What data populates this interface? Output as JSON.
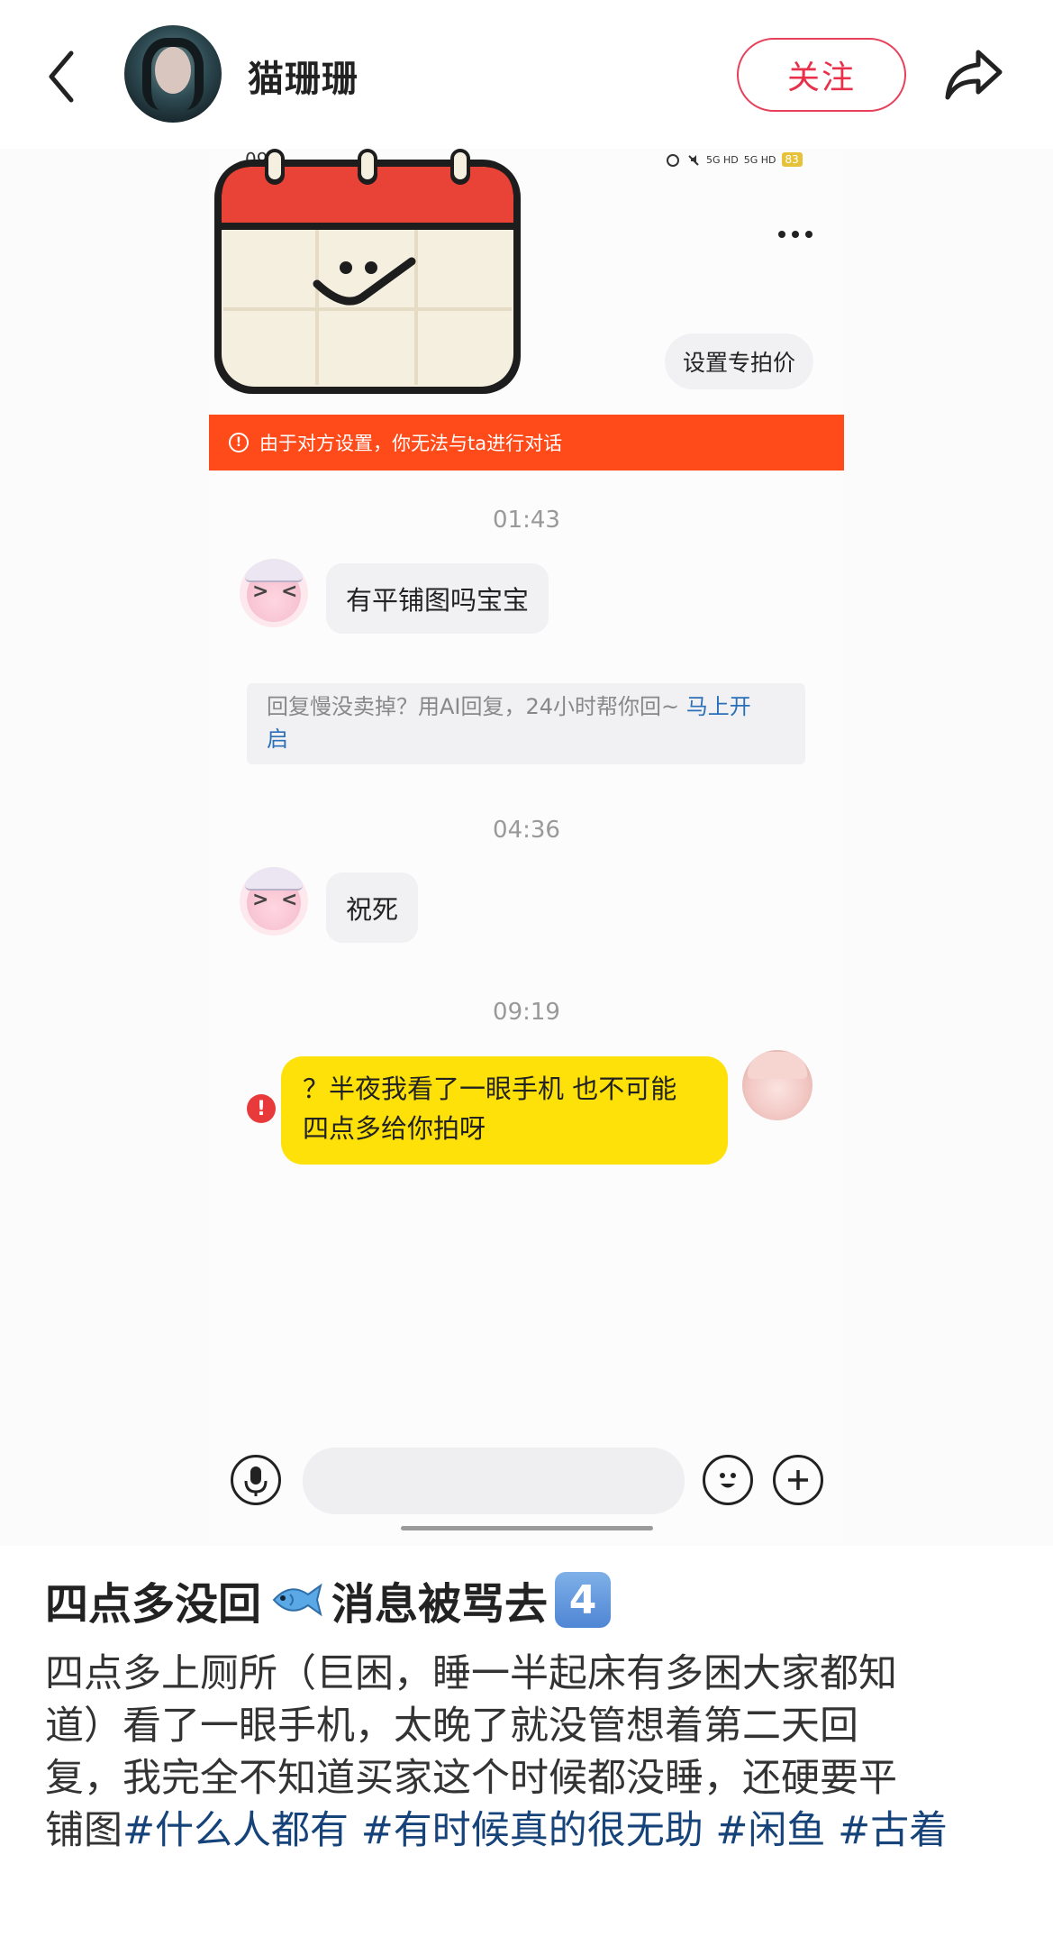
{
  "header": {
    "author_name": "猫珊珊",
    "follow_label": "关注"
  },
  "screenshot": {
    "status_time": "09",
    "battery": "83",
    "signal_labels": [
      "5G HD",
      "5G HD"
    ],
    "price_button": "设置专拍价",
    "banner_text": "由于对方设置，你无法与ta进行对话",
    "messages": [
      {
        "time": "01:43",
        "text": "有平铺图吗宝宝"
      },
      {
        "time": "04:36",
        "text": "祝死"
      },
      {
        "time": "09:19",
        "text_line1": "？半夜我看了一眼手机 也不可能",
        "text_line2": "四点多给你拍呀"
      }
    ],
    "ai_tip": {
      "text_part1": "回复慢没卖掉？用AI回复，24小时帮你回~ ",
      "link_part1": "马上开",
      "link_part2": "启"
    }
  },
  "post": {
    "title_part1": "四点多没回",
    "title_part2": "消息被骂去",
    "title_emoji_num": "4",
    "body_line1": "四点多上厕所（巨困，睡一半起床有多困大家都知",
    "body_line2": "道）看了一眼手机，太晚了就没管想着第二天回",
    "body_line3": "复，我完全不知道买家这个时候都没睡，还硬要平",
    "body_line4_prefix": "铺图",
    "hashtags": [
      "#什么人都有",
      "#有时候真的很无助",
      "#闲鱼",
      "#古着"
    ]
  },
  "colors": {
    "follow_red": "#e8304a",
    "banner_orange": "#ff4a1a",
    "my_bubble_yellow": "#ffe10a",
    "hashtag_blue": "#15437a",
    "link_blue": "#2a6fb8"
  },
  "icons": [
    "back-icon",
    "share-icon",
    "more-icon",
    "warning-icon",
    "error-icon",
    "mic-icon",
    "emoji-icon",
    "plus-icon",
    "fish-emoji-icon",
    "keycap-4-icon"
  ]
}
